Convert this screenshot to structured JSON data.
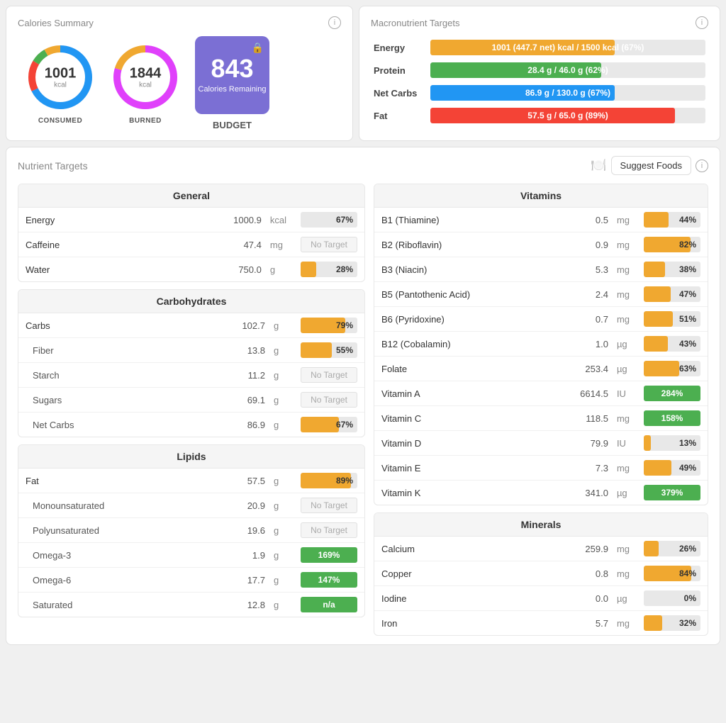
{
  "calories_summary": {
    "title": "Calories Summary",
    "consumed": {
      "value": "1001",
      "unit": "kcal",
      "label": "CONSUMED"
    },
    "burned": {
      "value": "1844",
      "unit": "kcal",
      "label": "BURNED"
    },
    "budget": {
      "value": "843",
      "desc": "Calories Remaining",
      "label": "BUDGET"
    }
  },
  "macro_targets": {
    "title": "Macronutrient Targets",
    "rows": [
      {
        "name": "Energy",
        "text": "1001 (447.7 net) kcal / 1500 kcal (67%)",
        "pct": 67,
        "color": "#f0a830"
      },
      {
        "name": "Protein",
        "text": "28.4 g / 46.0 g (62%)",
        "pct": 62,
        "color": "#4caf50"
      },
      {
        "name": "Net Carbs",
        "text": "86.9 g / 130.0 g (67%)",
        "pct": 67,
        "color": "#2196f3"
      },
      {
        "name": "Fat",
        "text": "57.5 g / 65.0 g (89%)",
        "pct": 89,
        "color": "#f44336"
      }
    ]
  },
  "nutrient_targets": {
    "title": "Nutrient Targets",
    "suggest_label": "Suggest Foods",
    "general": {
      "title": "General",
      "rows": [
        {
          "name": "Energy",
          "value": "1000.9",
          "unit": "kcal",
          "pct": "67%",
          "type": "orange"
        },
        {
          "name": "Caffeine",
          "value": "47.4",
          "unit": "mg",
          "pct": "No Target",
          "type": "no-target"
        },
        {
          "name": "Water",
          "value": "750.0",
          "unit": "g",
          "pct": "28%",
          "type": "orange",
          "pct_num": 28
        }
      ]
    },
    "carbohydrates": {
      "title": "Carbohydrates",
      "rows": [
        {
          "name": "Carbs",
          "value": "102.7",
          "unit": "g",
          "pct": "79%",
          "type": "orange",
          "pct_num": 79,
          "indented": false
        },
        {
          "name": "Fiber",
          "value": "13.8",
          "unit": "g",
          "pct": "55%",
          "type": "orange",
          "pct_num": 55,
          "indented": true
        },
        {
          "name": "Starch",
          "value": "11.2",
          "unit": "g",
          "pct": "No Target",
          "type": "no-target",
          "indented": true
        },
        {
          "name": "Sugars",
          "value": "69.1",
          "unit": "g",
          "pct": "No Target",
          "type": "no-target",
          "indented": true
        },
        {
          "name": "Net Carbs",
          "value": "86.9",
          "unit": "g",
          "pct": "67%",
          "type": "orange",
          "pct_num": 67,
          "indented": true
        }
      ]
    },
    "lipids": {
      "title": "Lipids",
      "rows": [
        {
          "name": "Fat",
          "value": "57.5",
          "unit": "g",
          "pct": "89%",
          "type": "orange",
          "pct_num": 89,
          "indented": false
        },
        {
          "name": "Monounsaturated",
          "value": "20.9",
          "unit": "g",
          "pct": "No Target",
          "type": "no-target",
          "indented": true
        },
        {
          "name": "Polyunsaturated",
          "value": "19.6",
          "unit": "g",
          "pct": "No Target",
          "type": "no-target",
          "indented": true
        },
        {
          "name": "Omega-3",
          "value": "1.9",
          "unit": "g",
          "pct": "169%",
          "type": "green",
          "pct_num": 100,
          "indented": true
        },
        {
          "name": "Omega-6",
          "value": "17.7",
          "unit": "g",
          "pct": "147%",
          "type": "green",
          "pct_num": 100,
          "indented": true
        },
        {
          "name": "Saturated",
          "value": "12.8",
          "unit": "g",
          "pct": "n/a",
          "type": "na",
          "pct_num": 100,
          "indented": true
        }
      ]
    },
    "vitamins": {
      "title": "Vitamins",
      "rows": [
        {
          "name": "B1 (Thiamine)",
          "value": "0.5",
          "unit": "mg",
          "pct": "44%",
          "type": "orange",
          "pct_num": 44
        },
        {
          "name": "B2 (Riboflavin)",
          "value": "0.9",
          "unit": "mg",
          "pct": "82%",
          "type": "orange",
          "pct_num": 82
        },
        {
          "name": "B3 (Niacin)",
          "value": "5.3",
          "unit": "mg",
          "pct": "38%",
          "type": "orange",
          "pct_num": 38
        },
        {
          "name": "B5 (Pantothenic Acid)",
          "value": "2.4",
          "unit": "mg",
          "pct": "47%",
          "type": "orange",
          "pct_num": 47
        },
        {
          "name": "B6 (Pyridoxine)",
          "value": "0.7",
          "unit": "mg",
          "pct": "51%",
          "type": "orange",
          "pct_num": 51
        },
        {
          "name": "B12 (Cobalamin)",
          "value": "1.0",
          "unit": "µg",
          "pct": "43%",
          "type": "orange",
          "pct_num": 43
        },
        {
          "name": "Folate",
          "value": "253.4",
          "unit": "µg",
          "pct": "63%",
          "type": "orange",
          "pct_num": 63
        },
        {
          "name": "Vitamin A",
          "value": "6614.5",
          "unit": "IU",
          "pct": "284%",
          "type": "green",
          "pct_num": 100
        },
        {
          "name": "Vitamin C",
          "value": "118.5",
          "unit": "mg",
          "pct": "158%",
          "type": "green",
          "pct_num": 100
        },
        {
          "name": "Vitamin D",
          "value": "79.9",
          "unit": "IU",
          "pct": "13%",
          "type": "orange",
          "pct_num": 13
        },
        {
          "name": "Vitamin E",
          "value": "7.3",
          "unit": "mg",
          "pct": "49%",
          "type": "orange",
          "pct_num": 49
        },
        {
          "name": "Vitamin K",
          "value": "341.0",
          "unit": "µg",
          "pct": "379%",
          "type": "green",
          "pct_num": 100
        }
      ]
    },
    "minerals": {
      "title": "Minerals",
      "rows": [
        {
          "name": "Calcium",
          "value": "259.9",
          "unit": "mg",
          "pct": "26%",
          "type": "orange",
          "pct_num": 26
        },
        {
          "name": "Copper",
          "value": "0.8",
          "unit": "mg",
          "pct": "84%",
          "type": "orange",
          "pct_num": 84
        },
        {
          "name": "Iodine",
          "value": "0.0",
          "unit": "µg",
          "pct": "0%",
          "type": "orange",
          "pct_num": 0
        },
        {
          "name": "Iron",
          "value": "5.7",
          "unit": "mg",
          "pct": "32%",
          "type": "orange",
          "pct_num": 32
        }
      ]
    }
  }
}
